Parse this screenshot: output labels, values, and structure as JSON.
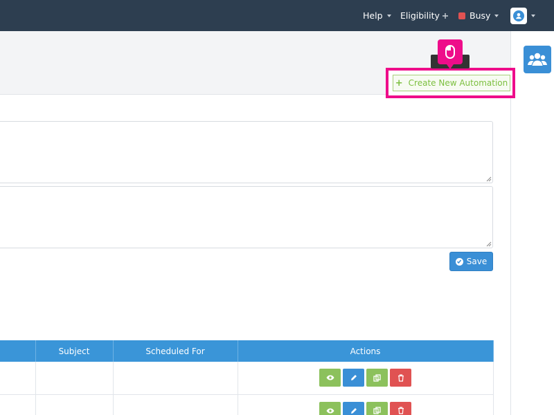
{
  "topbar": {
    "help_label": "Help",
    "eligibility_label": "Eligibility",
    "status_label": "Busy",
    "status_color": "#e05252"
  },
  "toolbar": {
    "create_label": "Create New Automation",
    "tooltip_text": "",
    "save_label": "Save"
  },
  "table": {
    "headers": [
      "",
      "Subject",
      "Scheduled For",
      "Actions"
    ],
    "rows": [
      {
        "col1": "",
        "subject": "",
        "scheduled": ""
      },
      {
        "col1": "",
        "subject": "",
        "scheduled": ""
      }
    ],
    "action_icons": [
      "eye-icon",
      "pencil-icon",
      "copy-icon",
      "trash-icon"
    ]
  },
  "colors": {
    "topbar": "#2d3e50",
    "primary": "#3a8fd6",
    "success": "#8cc15c",
    "danger": "#e05252",
    "highlight": "#ee0d8a"
  }
}
